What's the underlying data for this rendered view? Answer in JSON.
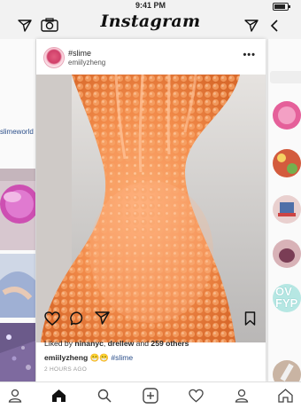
{
  "status_bar": {
    "time": "9:41 PM",
    "battery_level": 0.85
  },
  "header": {
    "logo": "Instagram",
    "left_icons": [
      "send-icon",
      "camera-icon"
    ],
    "right_icons": [
      "send-icon",
      "back-chevron-icon"
    ]
  },
  "left_panel": {
    "partial_username": "slimeworld"
  },
  "post": {
    "hashtag_title": "#slime",
    "username": "emiilyzheng",
    "more_label": "•••",
    "actions": [
      "heart-icon",
      "comment-icon",
      "share-icon",
      "bookmark-icon"
    ],
    "likes": {
      "prefix": "Liked by ",
      "user1": "ninanyc",
      "sep": ", ",
      "user2": "drellew",
      "mid": " and ",
      "count": "259 others"
    },
    "caption": {
      "user": "emiilyzheng",
      "emoji": "😁😁",
      "hashtag": "#slime"
    },
    "time": "2 HOURS AGO"
  },
  "right_panel": {
    "partial_text": "OV\nFYP"
  },
  "bottom_nav": [
    "profile-icon",
    "home-icon",
    "search-icon",
    "add-icon",
    "activity-heart-icon",
    "profile-icon",
    "home-icon"
  ],
  "colors": {
    "accent_link": "#2c4f8a",
    "slime": "#f08a4b"
  }
}
